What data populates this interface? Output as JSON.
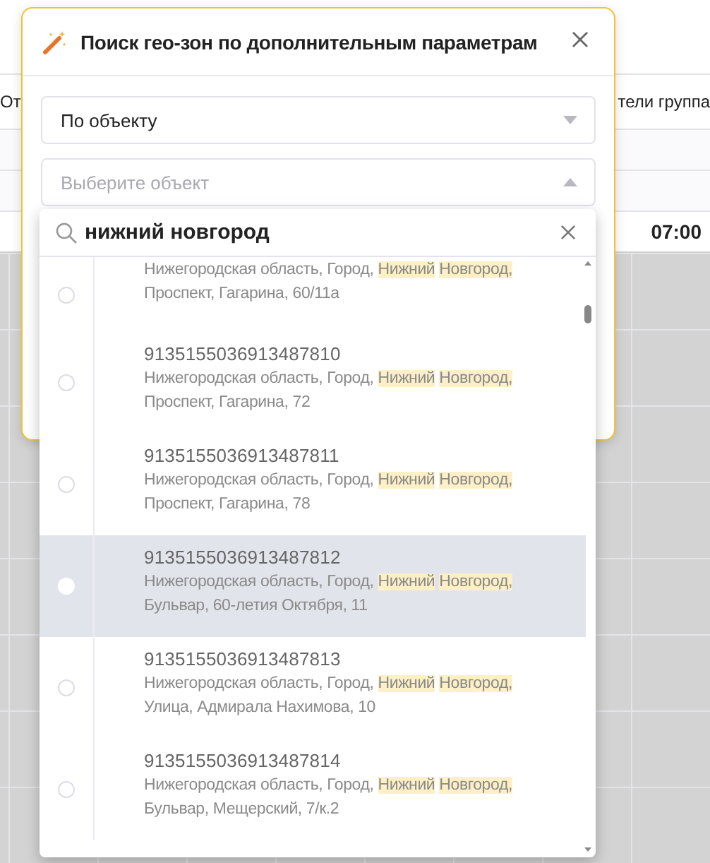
{
  "background": {
    "header_left": "От",
    "header_right": "тели группа",
    "time": "07:00"
  },
  "dialog": {
    "title": "Поиск гео-зон по дополнительным параметрам",
    "mode_select": {
      "value": "По объекту",
      "expanded": false
    },
    "object_select": {
      "placeholder": "Выберите объект",
      "expanded": true
    }
  },
  "dropdown": {
    "search": {
      "value": "нижний новгород"
    },
    "items": [
      {
        "selected": false,
        "address": {
          "before": "Нижегородская область, Город, ",
          "match": "Нижний Новгород,",
          "after": " Проспект, Гагарина, 60/11а"
        }
      },
      {
        "number": "9135155036913487810",
        "selected": false,
        "address": {
          "before": "Нижегородская область, Город, ",
          "match": "Нижний Новгород,",
          "after": " Проспект, Гагарина, 72"
        }
      },
      {
        "number": "9135155036913487811",
        "selected": false,
        "address": {
          "before": "Нижегородская область, Город, ",
          "match": "Нижний Новгород,",
          "after": " Проспект, Гагарина, 78"
        }
      },
      {
        "number": "9135155036913487812",
        "selected": true,
        "address": {
          "before": "Нижегородская область, Город, ",
          "match": "Нижний Новгород,",
          "after": " Бульвар, 60-летия Октября, 11"
        }
      },
      {
        "number": "9135155036913487813",
        "selected": false,
        "address": {
          "before": "Нижегородская область, Город, ",
          "match": "Нижний Новгород,",
          "after": " Улица, Адмирала Нахимова, 10"
        }
      },
      {
        "number": "9135155036913487814",
        "selected": false,
        "address": {
          "before": "Нижегородская область, Город, ",
          "match": "Нижний Новгород,",
          "after": " Бульвар, Мещерский, 7/к.2"
        }
      }
    ]
  }
}
